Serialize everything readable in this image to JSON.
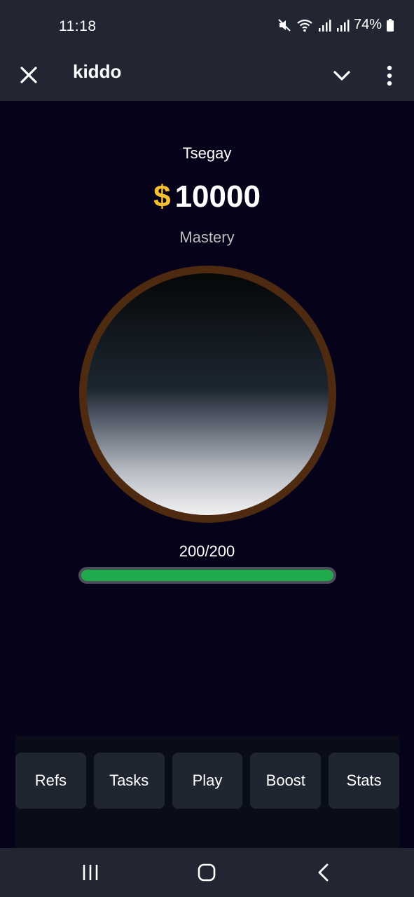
{
  "status_bar": {
    "time": "11:18",
    "battery_percent": "74%",
    "icons": [
      "mute-icon",
      "wifi-icon",
      "signal-icon",
      "signal-icon",
      "battery-icon"
    ]
  },
  "header": {
    "title": "kiddo",
    "icons": [
      "close-icon",
      "chevron-down-icon",
      "more-vertical-icon"
    ]
  },
  "profile": {
    "username": "Tsegay",
    "currency_symbol": "$",
    "balance": "10000",
    "level": "Mastery"
  },
  "energy": {
    "text": "200/200",
    "current": 200,
    "max": 200,
    "fraction": 1.0
  },
  "nav": {
    "items": [
      {
        "label": "Refs"
      },
      {
        "label": "Tasks"
      },
      {
        "label": "Play"
      },
      {
        "label": "Boost"
      },
      {
        "label": "Stats"
      }
    ]
  },
  "colors": {
    "background": "#06021a",
    "header": "#222633",
    "accent_gold": "#f5c12e",
    "energy_green": "#1faa4c",
    "circle_border": "#4d2a10",
    "nav_button": "#1f2531"
  },
  "system_nav": {
    "icons": [
      "recent-apps-icon",
      "home-icon",
      "back-icon"
    ]
  }
}
